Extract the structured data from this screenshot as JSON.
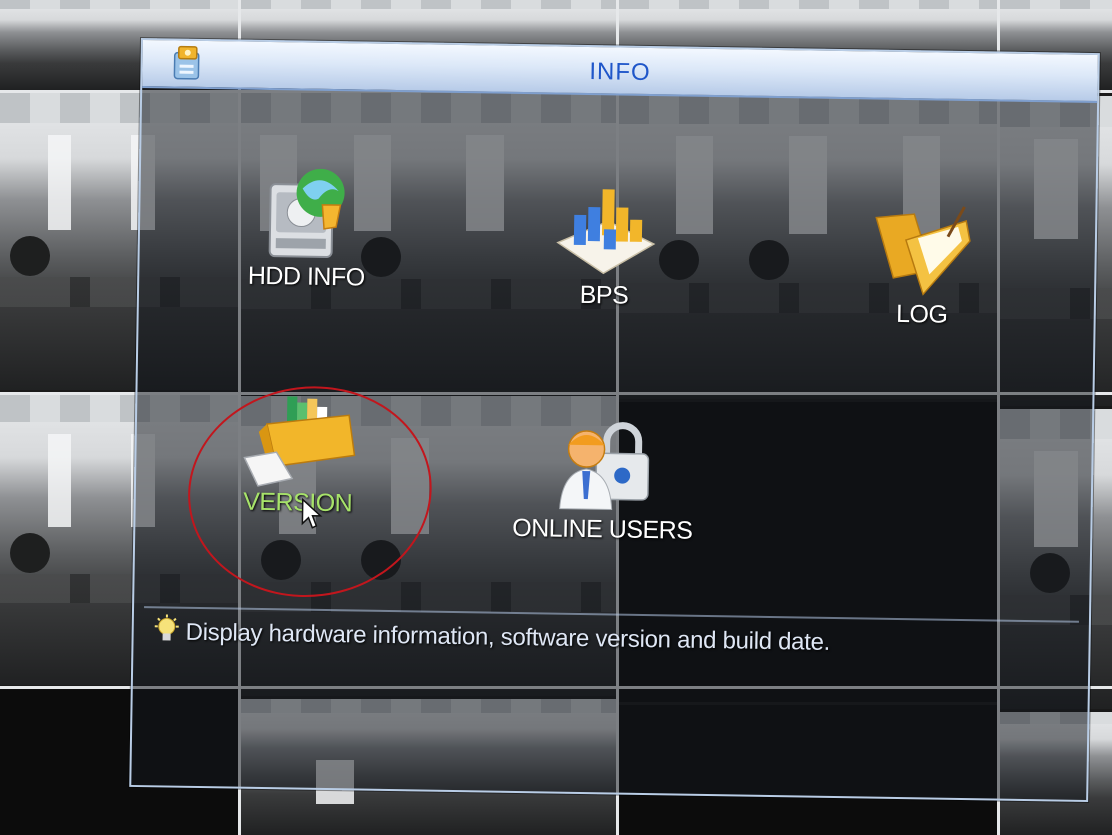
{
  "dialog": {
    "title": "INFO",
    "items": [
      {
        "label": "HDD INFO",
        "icon": "hdd-info-icon",
        "selected": false
      },
      {
        "label": "BPS",
        "icon": "bps-chart-icon",
        "selected": false
      },
      {
        "label": "LOG",
        "icon": "log-folder-icon",
        "selected": false
      },
      {
        "label": "VERSION",
        "icon": "version-box-icon",
        "selected": true
      },
      {
        "label": "ONLINE USERS",
        "icon": "online-users-lock-icon",
        "selected": false
      }
    ],
    "hint": "Display hardware information, software version and build date."
  },
  "colors": {
    "title_text": "#1f56c9",
    "label_text": "#ffffff",
    "selected_label": "#a7e36a",
    "highlight_ring": "#c2161d",
    "dialog_border": "#b9cde6"
  }
}
